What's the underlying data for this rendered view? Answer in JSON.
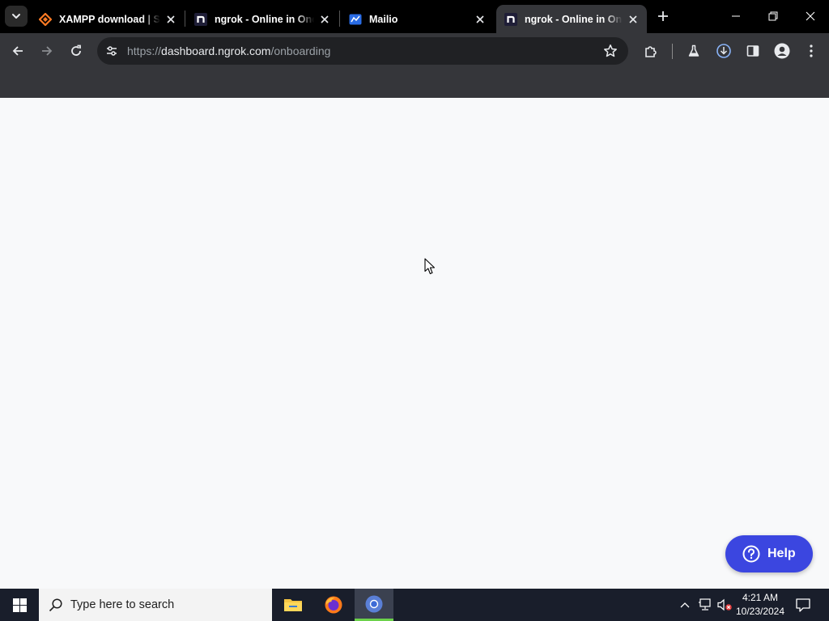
{
  "browser": {
    "tabs": [
      {
        "title": "XAMPP download | SourceForge.net",
        "favicon": "xampp-logo-icon",
        "active": false
      },
      {
        "title": "ngrok - Online in One Line",
        "favicon": "ngrok-logo-icon",
        "active": false
      },
      {
        "title": "Mailio",
        "favicon": "mailio-logo-icon",
        "active": false
      },
      {
        "title": "ngrok - Online in One Line",
        "favicon": "ngrok-logo-icon",
        "active": true
      }
    ],
    "address_bar": {
      "scheme": "https://",
      "host": "dashboard.ngrok.com",
      "path": "/onboarding"
    }
  },
  "page": {
    "help_label": "Help",
    "help_color": "#3b46e0"
  },
  "taskbar": {
    "search_placeholder": "Type here to search",
    "time": "4:21 AM",
    "date": "10/23/2024",
    "apps": [
      "file-explorer-icon",
      "firefox-icon",
      "chrome-icon"
    ]
  }
}
